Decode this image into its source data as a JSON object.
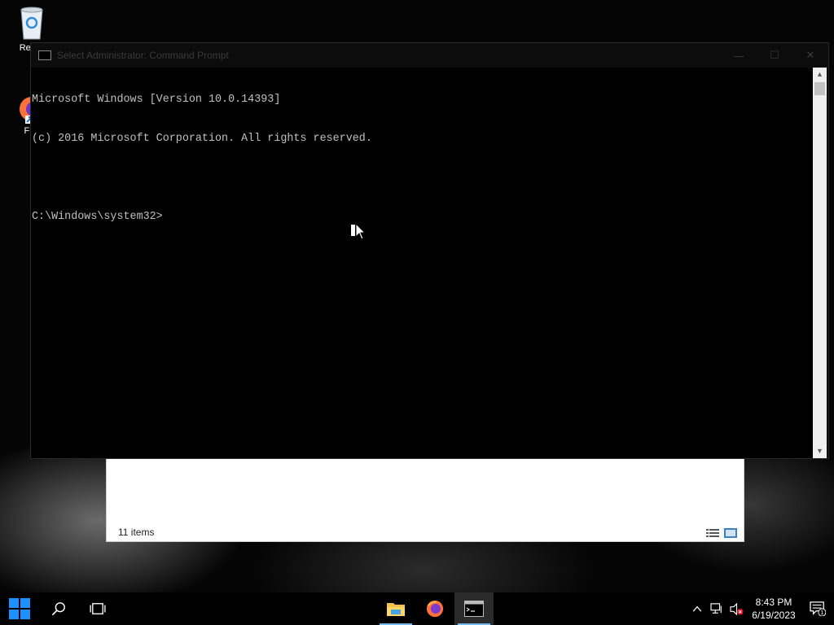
{
  "desktop": {
    "icons": [
      {
        "label": "Recyc",
        "icon": "recycle-bin-icon"
      },
      {
        "label": "Fire",
        "icon": "firefox-icon"
      }
    ]
  },
  "explorer": {
    "status": "11 items"
  },
  "cmd": {
    "title": "Select Administrator: Command Prompt",
    "lines": [
      "Microsoft Windows [Version 10.0.14393]",
      "(c) 2016 Microsoft Corporation. All rights reserved.",
      "",
      "C:\\Windows\\system32>"
    ],
    "controls": {
      "minimize": "—",
      "maximize": "☐",
      "close": "✕"
    }
  },
  "taskbar": {
    "apps": [
      "start-icon",
      "search-icon",
      "task-view-icon",
      "file-explorer-icon",
      "firefox-icon",
      "command-prompt-icon"
    ],
    "clock": {
      "time": "8:43 PM",
      "date": "6/19/2023"
    },
    "notification_count": "1"
  },
  "colors": {
    "console_text": "#c0c0c0",
    "taskbar_accent": "#76b9ed",
    "windows_blue": "#1e90ff"
  }
}
